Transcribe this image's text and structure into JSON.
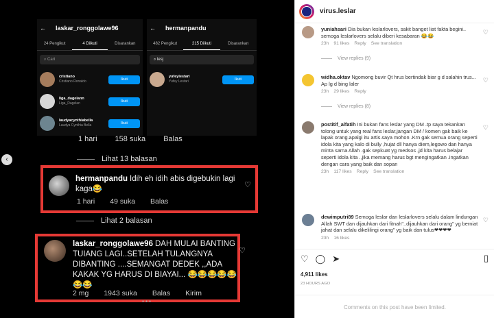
{
  "left_panel": {
    "phone1": {
      "title": "laskar_ronggolawe96",
      "tabs": [
        "24 Pengikut",
        "4 Diikuti",
        "Disarankan"
      ],
      "search_placeholder": "Cari",
      "users": [
        {
          "handle": "cristiano",
          "name": "Cristiano Ronaldo",
          "button": "Ikuti"
        },
        {
          "handle": "liga_dagelann",
          "name": "Liga_Dagelan",
          "button": "Ikuti"
        },
        {
          "handle": "laudyacynthiabella",
          "name": "Laudya Cynthia Bella",
          "button": "Ikuti"
        }
      ]
    },
    "phone2": {
      "title": "hermanpandu",
      "tabs": [
        "482 Pengikut",
        "215 Diikuti",
        "Disarankan"
      ],
      "search_value": "lesj",
      "users": [
        {
          "handle": "yufeylestari",
          "name": "Yufey Lestari",
          "button": "Ikuti"
        }
      ]
    },
    "top_meta": {
      "time": "1 hari",
      "likes": "158 suka",
      "reply": "Balas"
    },
    "view_replies_1": "Lihat 13 balasan",
    "comment1": {
      "username": "hermanpandu",
      "text": "Idih eh idih abis digebukin lagi kaga😂",
      "time": "1 hari",
      "likes": "49 suka",
      "reply": "Balas"
    },
    "view_replies_2": "Lihat 2 balasan",
    "comment2": {
      "username": "laskar_ronggolawe96",
      "text": "DAH MULAI BANTING TUIANG LAGI..SETELAH TULANGNYA DIBANTING ....SEMANGAT DEDEK ,,ADA KAKAK YG HARUS DI BIAYAI... 😂😂😂😂😂😂😂",
      "time": "2 mg",
      "likes": "1943 suka",
      "reply": "Balas",
      "send": "Kirim"
    }
  },
  "right_panel": {
    "account": "virus.leslar",
    "comments": [
      {
        "username": "yuniahsari",
        "text": "Dia bukan leslarlovers, sakit banget liat fakta begini.. semoga leslarlovers selalu diberi kesabaran 😂😂",
        "time": "23h",
        "likes": "91 likes",
        "reply": "Reply",
        "translate": "See translation",
        "view": "View replies (9)"
      },
      {
        "username": "widha.oktav",
        "text": "Ngomong buvir Qt hrus bertindak biar g d salahin trus... Ap lg d bing laler",
        "time": "23h",
        "likes": "29 likes",
        "reply": "Reply",
        "translate": "",
        "view": "View replies (8)"
      },
      {
        "username": "postitif_alfatih",
        "text": "Ini bukan fans leslar yang DM .tp saya tekankan tolong untuk yang real fans leslar,jangan DM / komen gak baik ke lapak orang.apalgi itu artis.saya mohon .Krn gak semua orang seperti idola kita yang kalo di bully ,hujat dll hanya diem,legowo dan hanya minta sama Allah .gak sepkuat yg medsos ,jd kita harus belajar seperti idola kita .,jika memang harus bgt mengingatkan .ingatkan dengan cara yang baik dan sopan",
        "time": "23h",
        "likes": "117 likes",
        "reply": "Reply",
        "translate": "See translation",
        "view": ""
      },
      {
        "username": "dewimputri89",
        "text": "Semoga leslar dan leslarlovers selalu dalam lindungan Allah SWT dan dijauhkan dari fitnah\"..dijauhkan dari orang\" yg berniat jahat dan selalu dikelilingi orang\" yg baik dan tulus❤❤❤❤",
        "time": "23h",
        "likes": "16 likes",
        "reply": "",
        "translate": "",
        "view": ""
      }
    ],
    "likes_total": "4,911 likes",
    "post_time": "23 HOURS AGO",
    "comments_off": "Comments on this post have been limited."
  }
}
